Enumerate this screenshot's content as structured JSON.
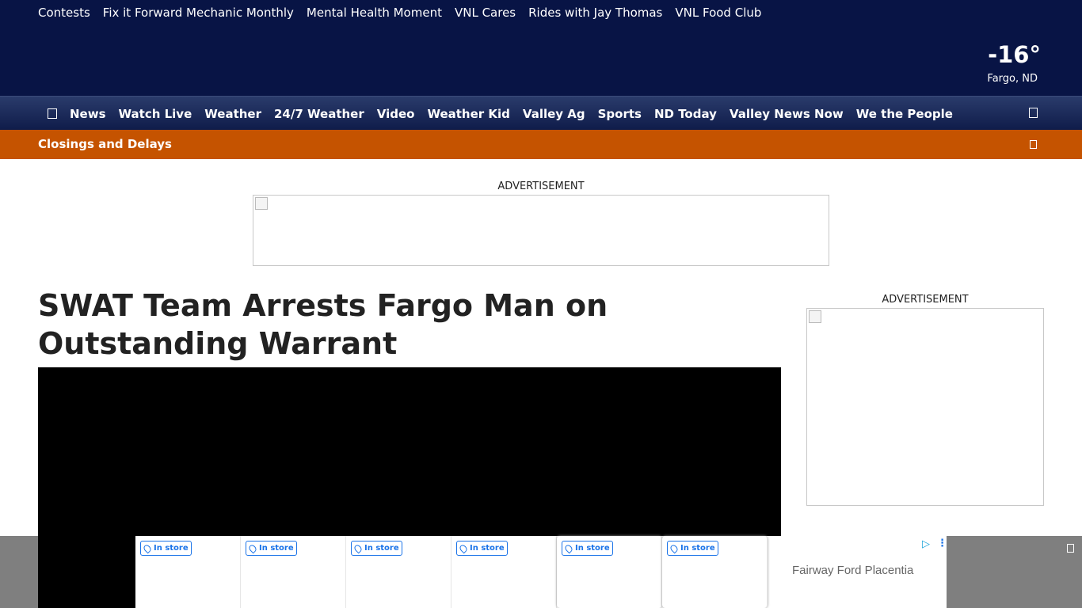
{
  "top_links": [
    "Contests",
    "Fix it Forward Mechanic Monthly",
    "Mental Health Moment",
    "VNL Cares",
    "Rides with Jay Thomas",
    "VNL Food Club"
  ],
  "weather": {
    "temperature": "-16°",
    "location": "Fargo, ND"
  },
  "nav": {
    "menu_icon": "menu-icon",
    "search_icon": "search-icon",
    "items": [
      "News",
      "Watch Live",
      "Weather",
      "24/7 Weather",
      "Video",
      "Weather Kid",
      "Valley Ag",
      "Sports",
      "ND Today",
      "Valley News Now",
      "We the People"
    ]
  },
  "closings": {
    "label": "Closings and Delays"
  },
  "ads": {
    "top_label": "ADVERTISEMENT",
    "side_label": "ADVERTISEMENT"
  },
  "article": {
    "headline": "SWAT Team Arrests Fargo Man on Outstanding Warrant"
  },
  "bottom_ad": {
    "cards": [
      "In store",
      "In store",
      "In store",
      "In store",
      "In store",
      "In store"
    ],
    "advertiser": "Fairway Ford Placentia",
    "adchoices_icon": "▷",
    "menu_icon": "⋮"
  },
  "colors": {
    "header": "#081445",
    "closings": "#c55300",
    "badge": "#1a73e8"
  }
}
